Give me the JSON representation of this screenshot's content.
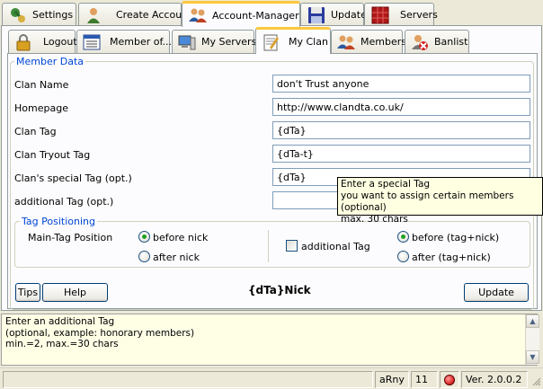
{
  "top_tabs": [
    {
      "label": "Settings",
      "icon": "wrench-icon"
    },
    {
      "label": "Create Account",
      "icon": "user-add-icon"
    },
    {
      "label": "Account-Manager",
      "icon": "users-icon"
    },
    {
      "label": "Update",
      "icon": "floppy-disk-icon"
    },
    {
      "label": "Servers",
      "icon": "server-grid-icon"
    }
  ],
  "sub_tabs": [
    {
      "label": "Logout",
      "icon": "padlock-icon"
    },
    {
      "label": "Member of...",
      "icon": "list-window-icon"
    },
    {
      "label": "My Servers",
      "icon": "computer-icon"
    },
    {
      "label": "My Clan",
      "icon": "notepad-icon"
    },
    {
      "label": "Members",
      "icon": "users-icon"
    },
    {
      "label": "Banlist",
      "icon": "user-banned-icon"
    }
  ],
  "member_data": {
    "title": "Member Data",
    "fields": [
      {
        "label": "Clan Name",
        "value": "don't Trust anyone"
      },
      {
        "label": "Homepage",
        "value": "http://www.clandta.co.uk/"
      },
      {
        "label": "Clan Tag",
        "value": "{dTa}"
      },
      {
        "label": "Clan Tryout Tag",
        "value": "{dTa-t}"
      },
      {
        "label": "Clan's special Tag (opt.)",
        "value": "{dTa}"
      },
      {
        "label": "additional Tag (opt.)",
        "value": ""
      }
    ]
  },
  "tooltip": {
    "line1": "Enter a special Tag",
    "line2": "you want to assign certain members (optional)",
    "line3": "max. 30 chars"
  },
  "tag_positioning": {
    "title": "Tag Positioning",
    "main_label": "Main-Tag Position",
    "before_nick": "before nick",
    "after_nick": "after nick",
    "additional_tag": "additional Tag",
    "before_tag_nick": "before (tag+nick)",
    "after_tag_nick": "after (tag+nick)"
  },
  "buttons": {
    "tips": "Tips",
    "help": "Help",
    "update": "Update"
  },
  "preview": "{dTa}Nick",
  "info": {
    "line1": "Enter an additional Tag",
    "line2": "(optional, example: honorary members)",
    "line3": "min.=2, max.=30 chars"
  },
  "status": {
    "user": "aRny",
    "count": "11",
    "version": "Ver. 2.0.0.2"
  },
  "colors": {
    "accent_tab": "#ffc83c",
    "group_title": "#0046d5",
    "radio_dot": "#21a121",
    "status_light": "#e03030"
  }
}
